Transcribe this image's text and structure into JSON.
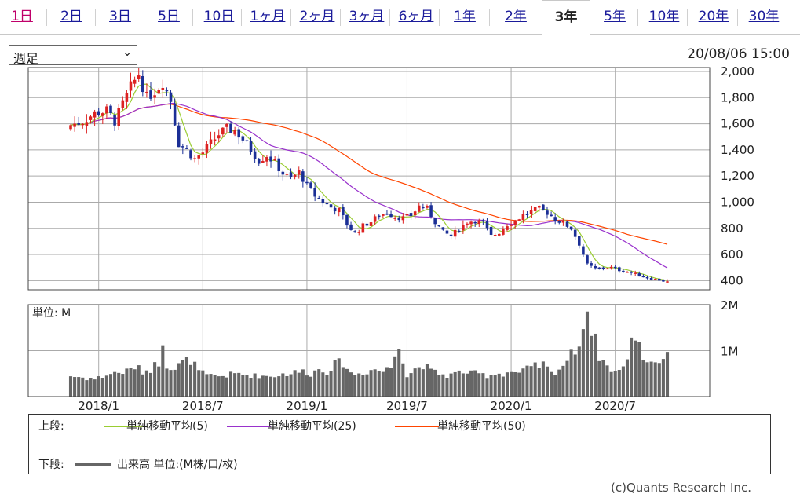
{
  "tabs": [
    {
      "label": "1日"
    },
    {
      "label": "2日"
    },
    {
      "label": "3日"
    },
    {
      "label": "5日"
    },
    {
      "label": "10日"
    },
    {
      "label": "1ヶ月"
    },
    {
      "label": "2ヶ月"
    },
    {
      "label": "3ヶ月"
    },
    {
      "label": "6ヶ月"
    },
    {
      "label": "1年"
    },
    {
      "label": "2年"
    },
    {
      "label": "3年"
    },
    {
      "label": "5年"
    },
    {
      "label": "10年"
    },
    {
      "label": "20年"
    },
    {
      "label": "30年"
    }
  ],
  "active_tab": "3年",
  "period_select": {
    "value": "週足"
  },
  "timestamp": "20/08/06 15:00",
  "legend": {
    "upper_label": "上段:",
    "lower_label": "下段:",
    "ma5": "単純移動平均(5)",
    "ma25": "単純移動平均(25)",
    "ma50": "単純移動平均(50)",
    "volume": "出来高 単位:(M株/口/枚)"
  },
  "credit": "(c)Quants Research Inc.",
  "colors": {
    "up": "#dd2222",
    "down": "#1b2f96",
    "ma5": "#9acd32",
    "ma25": "#9932cc",
    "ma50": "#ff4500",
    "volume": "#666666",
    "grid": "#aaaaaa",
    "tab_link": "#1a1a9a",
    "tab_first": "#c0006a"
  },
  "chart_data": {
    "type": "candlestick",
    "price_axis": {
      "ticks": [
        "2,000",
        "1,800",
        "1,600",
        "1,400",
        "1,200",
        "1,000",
        "800",
        "600",
        "400"
      ],
      "ylim": [
        330,
        2030
      ]
    },
    "volume_axis": {
      "ticks": [
        "2M",
        "1M"
      ],
      "unit_label": "単位: M",
      "ylim": [
        0,
        2.0
      ]
    },
    "x_ticks": [
      "2018/1",
      "2018/7",
      "2019/1",
      "2019/7",
      "2020/1",
      "2020/7"
    ],
    "x_tick_weeks": [
      7,
      33,
      59,
      84,
      110,
      136
    ],
    "weeks": 150,
    "close_anchors": [
      [
        0,
        1590
      ],
      [
        3,
        1620
      ],
      [
        6,
        1680
      ],
      [
        9,
        1700
      ],
      [
        11,
        1620
      ],
      [
        13,
        1750
      ],
      [
        15,
        1880
      ],
      [
        17,
        1980
      ],
      [
        19,
        1800
      ],
      [
        21,
        1850
      ],
      [
        23,
        1920
      ],
      [
        25,
        1780
      ],
      [
        27,
        1450
      ],
      [
        29,
        1400
      ],
      [
        31,
        1330
      ],
      [
        33,
        1380
      ],
      [
        35,
        1450
      ],
      [
        37,
        1520
      ],
      [
        39,
        1560
      ],
      [
        41,
        1550
      ],
      [
        43,
        1480
      ],
      [
        45,
        1400
      ],
      [
        47,
        1320
      ],
      [
        49,
        1360
      ],
      [
        51,
        1300
      ],
      [
        53,
        1220
      ],
      [
        55,
        1180
      ],
      [
        57,
        1230
      ],
      [
        59,
        1130
      ],
      [
        61,
        1050
      ],
      [
        63,
        1000
      ],
      [
        65,
        960
      ],
      [
        67,
        940
      ],
      [
        69,
        830
      ],
      [
        71,
        760
      ],
      [
        73,
        820
      ],
      [
        75,
        850
      ],
      [
        77,
        900
      ],
      [
        79,
        920
      ],
      [
        81,
        890
      ],
      [
        83,
        880
      ],
      [
        85,
        900
      ],
      [
        87,
        970
      ],
      [
        89,
        950
      ],
      [
        91,
        850
      ],
      [
        93,
        770
      ],
      [
        95,
        740
      ],
      [
        97,
        800
      ],
      [
        99,
        850
      ],
      [
        101,
        860
      ],
      [
        103,
        840
      ],
      [
        105,
        740
      ],
      [
        107,
        770
      ],
      [
        109,
        830
      ],
      [
        111,
        860
      ],
      [
        113,
        900
      ],
      [
        115,
        930
      ],
      [
        117,
        950
      ],
      [
        119,
        920
      ],
      [
        121,
        870
      ],
      [
        123,
        840
      ],
      [
        125,
        800
      ],
      [
        127,
        680
      ],
      [
        129,
        520
      ],
      [
        131,
        490
      ],
      [
        133,
        500
      ],
      [
        135,
        500
      ],
      [
        137,
        480
      ],
      [
        139,
        470
      ],
      [
        141,
        450
      ],
      [
        143,
        430
      ],
      [
        145,
        415
      ],
      [
        147,
        405
      ],
      [
        149,
        390
      ]
    ],
    "volume_anchors": [
      [
        0,
        0.45
      ],
      [
        6,
        0.38
      ],
      [
        10,
        0.5
      ],
      [
        14,
        0.55
      ],
      [
        16,
        0.65
      ],
      [
        18,
        0.55
      ],
      [
        20,
        0.6
      ],
      [
        22,
        0.75
      ],
      [
        23,
        1.25
      ],
      [
        24,
        0.7
      ],
      [
        26,
        0.6
      ],
      [
        28,
        0.75
      ],
      [
        30,
        0.8
      ],
      [
        32,
        0.55
      ],
      [
        34,
        0.45
      ],
      [
        38,
        0.45
      ],
      [
        42,
        0.5
      ],
      [
        46,
        0.45
      ],
      [
        50,
        0.45
      ],
      [
        54,
        0.5
      ],
      [
        58,
        0.55
      ],
      [
        60,
        0.5
      ],
      [
        62,
        0.6
      ],
      [
        64,
        0.55
      ],
      [
        66,
        0.7
      ],
      [
        68,
        0.75
      ],
      [
        70,
        0.5
      ],
      [
        72,
        0.5
      ],
      [
        74,
        0.55
      ],
      [
        76,
        0.6
      ],
      [
        78,
        0.55
      ],
      [
        80,
        0.65
      ],
      [
        82,
        1.2
      ],
      [
        84,
        0.45
      ],
      [
        86,
        0.6
      ],
      [
        88,
        0.7
      ],
      [
        90,
        0.55
      ],
      [
        92,
        0.5
      ],
      [
        94,
        0.45
      ],
      [
        96,
        0.5
      ],
      [
        98,
        0.55
      ],
      [
        100,
        0.5
      ],
      [
        102,
        0.5
      ],
      [
        104,
        0.45
      ],
      [
        106,
        0.5
      ],
      [
        108,
        0.5
      ],
      [
        110,
        0.55
      ],
      [
        112,
        0.5
      ],
      [
        114,
        0.6
      ],
      [
        116,
        0.65
      ],
      [
        118,
        0.7
      ],
      [
        120,
        0.5
      ],
      [
        122,
        0.6
      ],
      [
        124,
        0.8
      ],
      [
        126,
        1.0
      ],
      [
        128,
        1.5
      ],
      [
        129,
        1.9
      ],
      [
        130,
        1.5
      ],
      [
        131,
        1.2
      ],
      [
        132,
        0.9
      ],
      [
        134,
        0.65
      ],
      [
        136,
        0.55
      ],
      [
        138,
        0.6
      ],
      [
        140,
        1.2
      ],
      [
        141,
        1.35
      ],
      [
        142,
        1.2
      ],
      [
        143,
        0.85
      ],
      [
        145,
        0.75
      ],
      [
        147,
        0.8
      ],
      [
        149,
        0.85
      ]
    ]
  }
}
